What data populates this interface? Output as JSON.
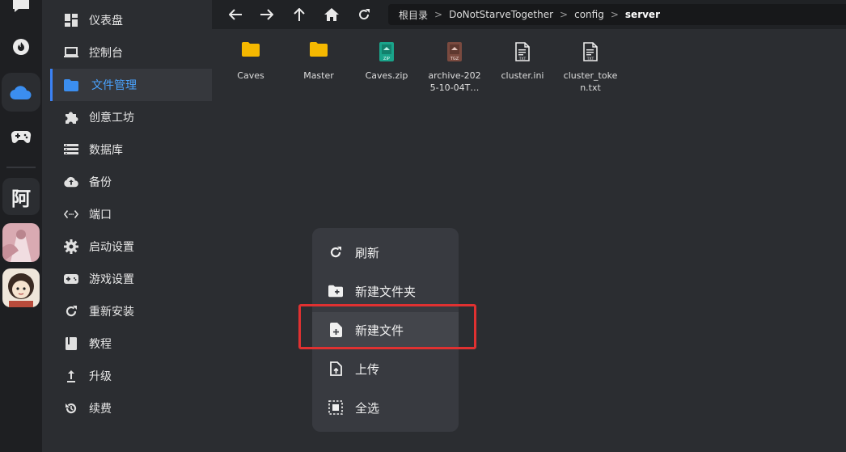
{
  "sidebar": {
    "items": [
      {
        "label": "仪表盘",
        "icon": "dashboard-icon"
      },
      {
        "label": "控制台",
        "icon": "laptop-icon"
      },
      {
        "label": "文件管理",
        "icon": "folder-icon",
        "active": true
      },
      {
        "label": "创意工坊",
        "icon": "puzzle-icon"
      },
      {
        "label": "数据库",
        "icon": "database-icon"
      },
      {
        "label": "备份",
        "icon": "cloud-upload-icon"
      },
      {
        "label": "端口",
        "icon": "code-arrows-icon"
      },
      {
        "label": "启动设置",
        "icon": "gear-icon"
      },
      {
        "label": "游戏设置",
        "icon": "gamepad-icon"
      },
      {
        "label": "重新安装",
        "icon": "refresh-icon"
      },
      {
        "label": "教程",
        "icon": "book-icon"
      },
      {
        "label": "升级",
        "icon": "arrow-up-icon"
      },
      {
        "label": "续费",
        "icon": "renew-icon"
      }
    ]
  },
  "rail": {
    "avatar_letter": "阿"
  },
  "breadcrumb": {
    "items": [
      "根目录",
      "DoNotStarveTogether",
      "config",
      "server"
    ],
    "separator": ">"
  },
  "files": [
    {
      "name": "Caves",
      "type": "folder"
    },
    {
      "name": "Master",
      "type": "folder"
    },
    {
      "name": "Caves.zip",
      "type": "zip"
    },
    {
      "name": "archive-2025-10-04T…",
      "type": "tgz"
    },
    {
      "name": "cluster.ini",
      "type": "txt"
    },
    {
      "name": "cluster_token.txt",
      "type": "txt"
    }
  ],
  "context_menu": {
    "items": [
      {
        "label": "刷新",
        "icon": "refresh-icon"
      },
      {
        "label": "新建文件夹",
        "icon": "new-folder-icon"
      },
      {
        "label": "新建文件",
        "icon": "new-file-icon",
        "highlighted": true
      },
      {
        "label": "上传",
        "icon": "upload-file-icon"
      },
      {
        "label": "全选",
        "icon": "select-all-icon"
      }
    ]
  },
  "colors": {
    "accent": "#3b82f6",
    "folder": "#f5b800",
    "highlight_border": "#e03131",
    "zip_icon": "#1aa38a",
    "tgz_icon": "#7a4a3f"
  }
}
